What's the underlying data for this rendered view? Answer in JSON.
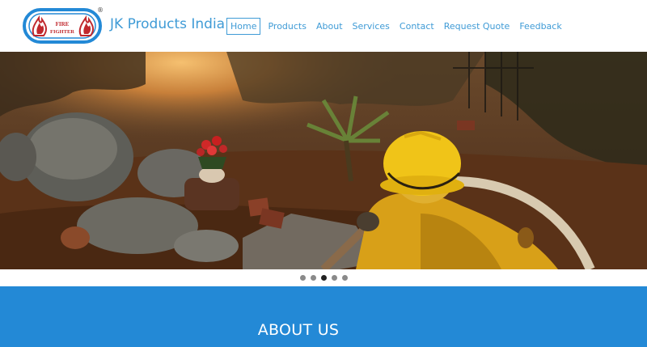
{
  "brand": {
    "name": "JK Products India",
    "logo_text_line1": "FIRE",
    "logo_text_line2": "FIGHTER",
    "registered_mark": "®"
  },
  "nav": {
    "items": [
      {
        "label": "Home",
        "active": true
      },
      {
        "label": "Products",
        "active": false
      },
      {
        "label": "About",
        "active": false
      },
      {
        "label": "Services",
        "active": false
      },
      {
        "label": "Contact",
        "active": false
      },
      {
        "label": "Request Quote",
        "active": false
      },
      {
        "label": "Feedback",
        "active": false
      }
    ]
  },
  "slider": {
    "slide_count": 5,
    "active_index": 2
  },
  "about": {
    "title": "ABOUT US"
  },
  "colors": {
    "accent": "#3f9bd6",
    "section_bg": "#2389d6"
  }
}
